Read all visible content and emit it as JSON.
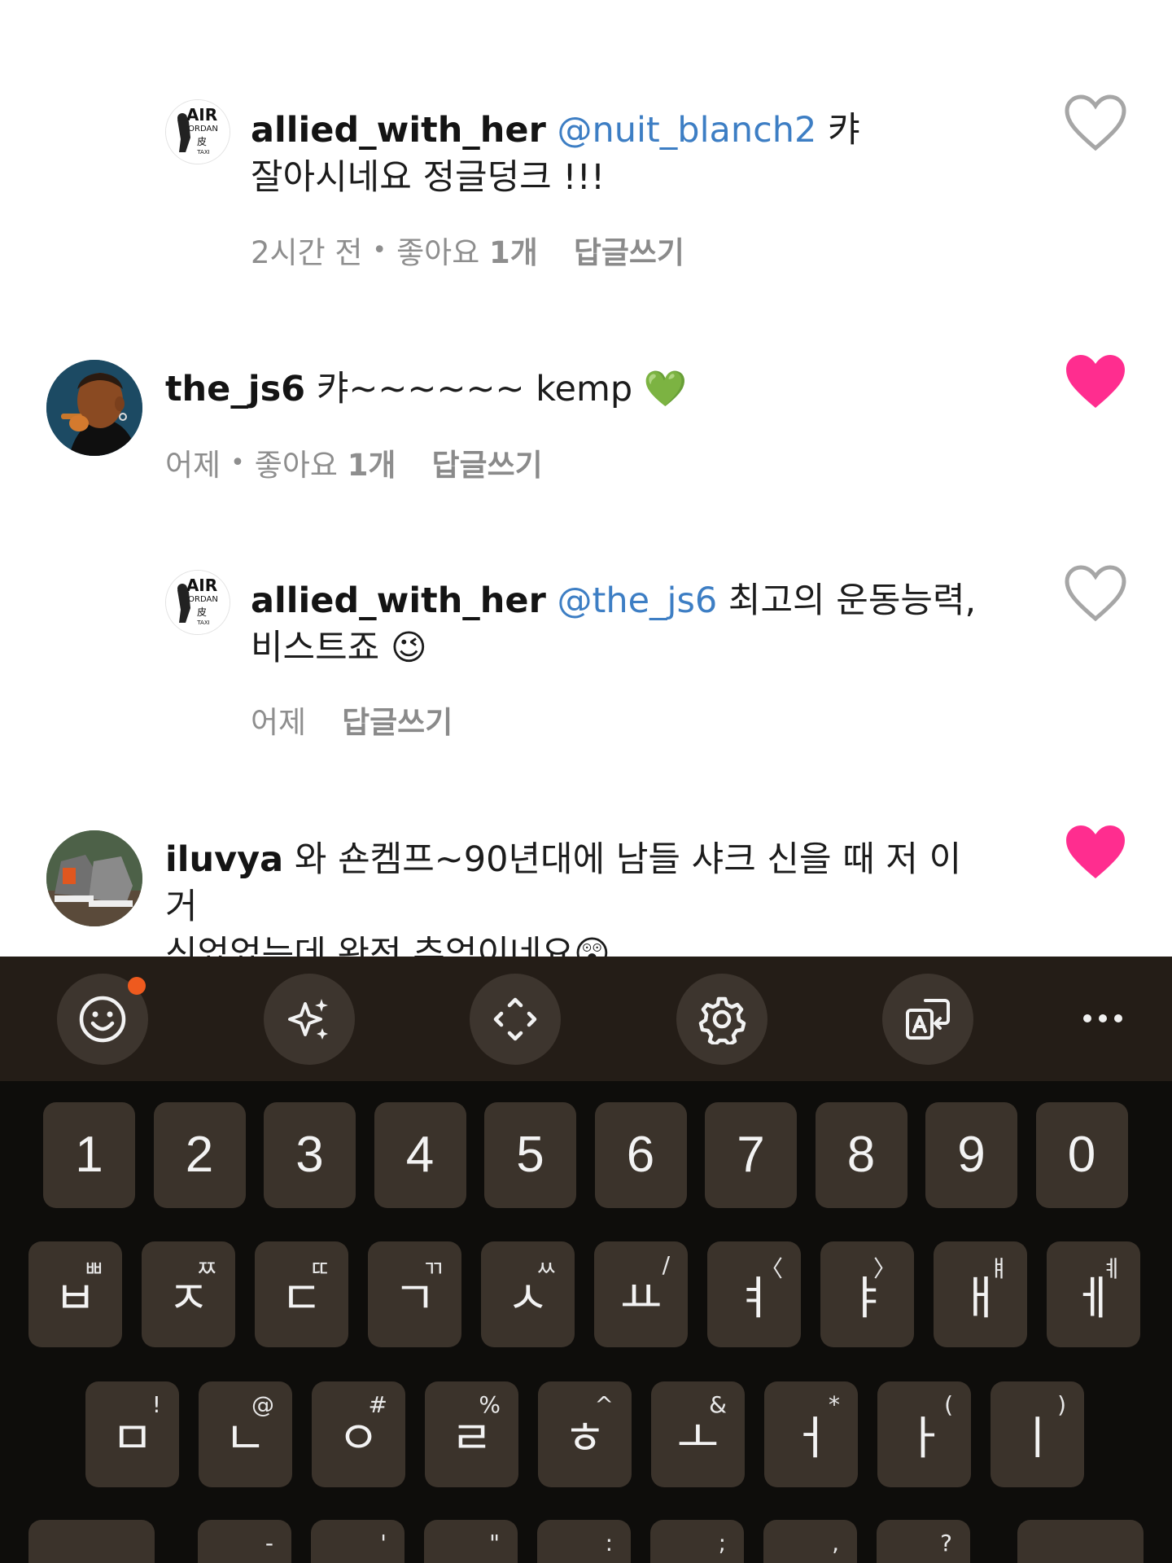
{
  "comments": [
    {
      "username": "allied_with_her",
      "mention": "@nuit_blanch2",
      "text_line1": " 캬",
      "text_line2": "잘아시네요 정글덩크 !!!",
      "time": "2시간 전",
      "likes_label": "좋아요 ",
      "likes_count": "1개",
      "reply_label": "답글쓰기",
      "liked": false
    },
    {
      "username": "the_js6",
      "text_line1": " 캬~~~~~~ kemp 💚",
      "time": "어제",
      "likes_label": "좋아요 ",
      "likes_count": "1개",
      "reply_label": "답글쓰기",
      "liked": true
    },
    {
      "username": "allied_with_her",
      "mention": "@the_js6",
      "text_line1": " 최고의 운동능력,",
      "text_line2": "비스트죠 😉",
      "time": "어제",
      "reply_label": "답글쓰기",
      "liked": false
    },
    {
      "username": "iluvya",
      "text_line1": " 와 숀켐프~90년대에 남들 샤크 신을 때 저 이거",
      "text_line2": "신었었는데 완전 추억이네요😲",
      "liked": true
    }
  ],
  "colors": {
    "heart_liked": "#ff2d8f",
    "heart_outline": "#a6a6a6",
    "mention": "#3d7ec4",
    "keyboard_bg": "#0e0d0b",
    "toolbar_bg": "#241d17",
    "key_bg": "#3b332b",
    "badge": "#ee5a1e"
  },
  "keyboard": {
    "toolbar_icons": [
      "emoji-icon",
      "sparkle-ai-icon",
      "cursor-move-icon",
      "settings-gear-icon",
      "translate-icon",
      "more-icon"
    ],
    "numbers": [
      "1",
      "2",
      "3",
      "4",
      "5",
      "6",
      "7",
      "8",
      "9",
      "0"
    ],
    "row1": [
      {
        "k": "ㅂ",
        "a": "ㅃ"
      },
      {
        "k": "ㅈ",
        "a": "ㅉ"
      },
      {
        "k": "ㄷ",
        "a": "ㄸ"
      },
      {
        "k": "ㄱ",
        "a": "ㄲ"
      },
      {
        "k": "ㅅ",
        "a": "ㅆ"
      },
      {
        "k": "ㅛ",
        "a": "/"
      },
      {
        "k": "ㅕ",
        "a": "〈"
      },
      {
        "k": "ㅑ",
        "a": "〉"
      },
      {
        "k": "ㅐ",
        "a": "ㅒ"
      },
      {
        "k": "ㅔ",
        "a": "ㅖ"
      }
    ],
    "row2": [
      {
        "k": "ㅁ",
        "a": "!"
      },
      {
        "k": "ㄴ",
        "a": "@"
      },
      {
        "k": "ㅇ",
        "a": "#"
      },
      {
        "k": "ㄹ",
        "a": "%"
      },
      {
        "k": "ㅎ",
        "a": "^"
      },
      {
        "k": "ㅗ",
        "a": "&"
      },
      {
        "k": "ㅓ",
        "a": "*"
      },
      {
        "k": "ㅏ",
        "a": "("
      },
      {
        "k": "ㅣ",
        "a": ")"
      }
    ],
    "row3_alts": [
      "-",
      "'",
      "\"",
      ":",
      ";",
      ",",
      "?"
    ]
  }
}
